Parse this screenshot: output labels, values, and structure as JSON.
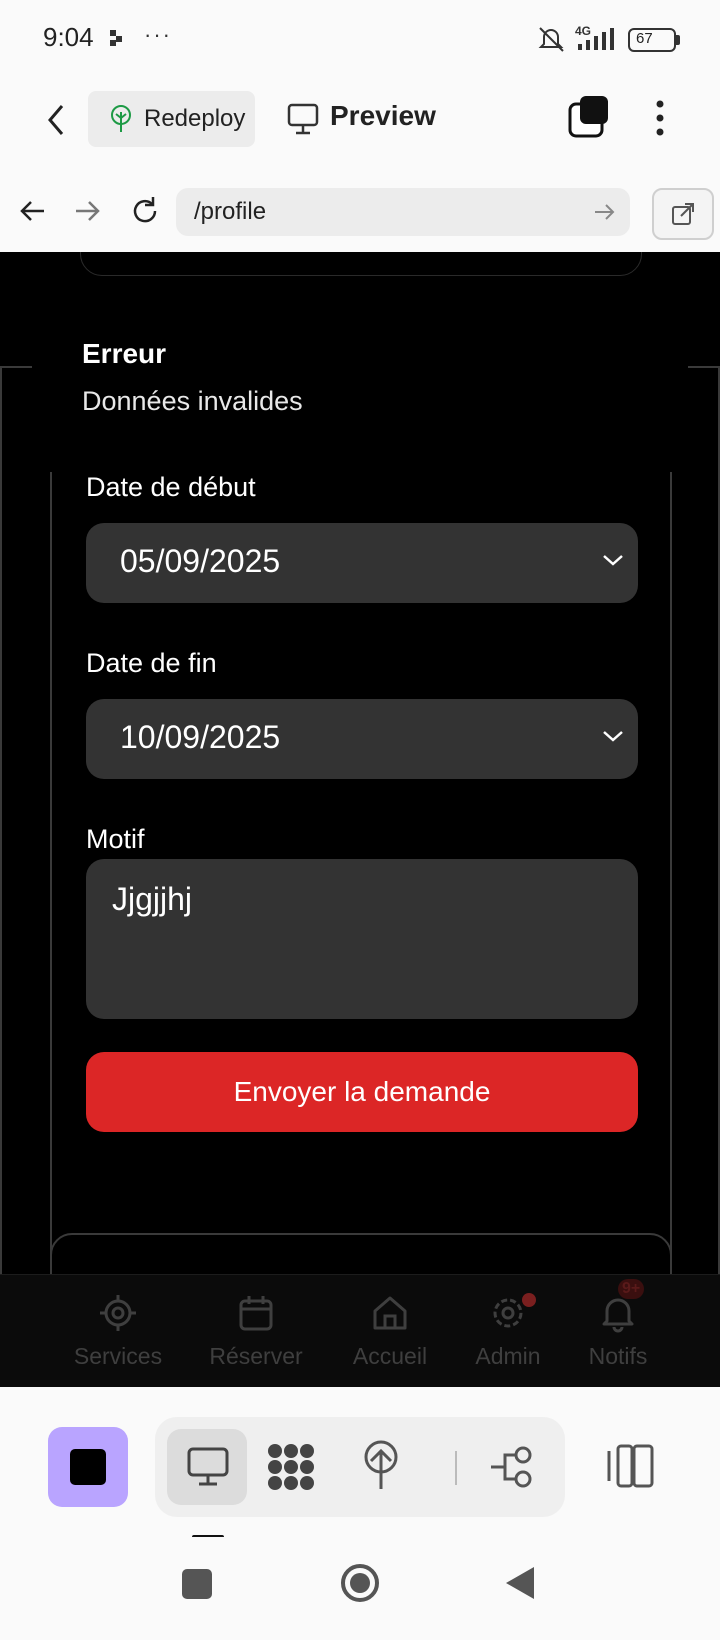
{
  "status_bar": {
    "time": "9:04",
    "dots": "···",
    "network": "4G",
    "battery": "67",
    "icons": [
      "mute-bell-icon",
      "signal-icon",
      "battery-icon"
    ]
  },
  "app_header": {
    "redeploy_label": "Redeploy",
    "preview_label": "Preview",
    "icons": [
      "back-arrow-icon",
      "tree-icon",
      "monitor-icon",
      "tabs-icon",
      "more-vertical-icon"
    ]
  },
  "browser": {
    "url": "/profile",
    "icons": [
      "back-icon",
      "forward-icon",
      "reload-icon",
      "go-arrow-icon",
      "open-external-icon"
    ]
  },
  "error": {
    "title": "Erreur",
    "message": "Données invalides"
  },
  "form": {
    "start_label": "Date de début",
    "start_value": "05/09/2025",
    "end_label": "Date de fin",
    "end_value": "10/09/2025",
    "reason_label": "Motif",
    "reason_value": "Jjgjjhj",
    "submit_label": "Envoyer la demande"
  },
  "bottom_nav": {
    "items": [
      {
        "label": "Services",
        "icon": "services-gear-icon"
      },
      {
        "label": "Réserver",
        "icon": "calendar-icon"
      },
      {
        "label": "Accueil",
        "icon": "home-icon"
      },
      {
        "label": "Admin",
        "icon": "settings-icon"
      },
      {
        "label": "Notifs",
        "icon": "bell-icon"
      }
    ],
    "notif_badge": "9+"
  },
  "dev_toolbar": {
    "icons": [
      "stop-icon",
      "monitor-icon",
      "grid-dots-icon",
      "tree-icon",
      "share-nodes-icon",
      "panel-icon"
    ],
    "accent": "#b9a4ff"
  },
  "system_nav": {
    "icons": [
      "recents-square-icon",
      "home-circle-icon",
      "back-triangle-icon"
    ]
  },
  "colors": {
    "submit_button": "#dc2626",
    "field_bg": "#333333",
    "content_bg": "#000000"
  }
}
